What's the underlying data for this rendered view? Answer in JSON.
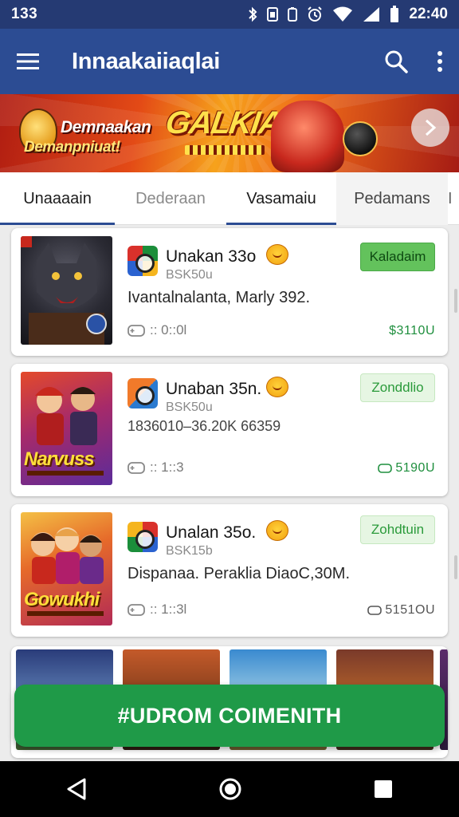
{
  "status_bar": {
    "time_left": "133",
    "clock": "22:40",
    "icons": [
      "bluetooth-icon",
      "sim-icon",
      "battery-saver-icon",
      "alarm-icon",
      "wifi-icon",
      "signal-icon",
      "battery-icon"
    ]
  },
  "app_bar": {
    "title": "Innaakaiiaqlai",
    "menu_icon": "menu-icon",
    "search_icon": "search-icon",
    "more_icon": "more-vert-icon",
    "color": "#2c4c93"
  },
  "banner": {
    "line1": "Demnaakan",
    "line2": "Demanpniuat!",
    "brand": "GALKIAN",
    "next_icon": "chevron-right-icon"
  },
  "tabs": [
    {
      "label": "Unaaaain",
      "active": true
    },
    {
      "label": "Dederaan",
      "active": false
    },
    {
      "label": "Vasamaiu",
      "active": true
    },
    {
      "label": "Pedamans",
      "active": false
    },
    {
      "label": "I",
      "active": false
    }
  ],
  "items": [
    {
      "name": "Unakan 33o",
      "sub": "BSK50u",
      "desc": "Ivantalnalanta, Marly 392.",
      "meta": ":: 0::0l",
      "price": "$3110U",
      "badge": "Kaladaim",
      "badge_style": "solid"
    },
    {
      "name": "Unaban 35n.",
      "sub": "BSK50u",
      "desc": "1836010–36.20K 66359",
      "meta": ":: 1::3",
      "price": "5190U",
      "badge": "Zonddlio",
      "badge_style": "light"
    },
    {
      "name": "Unalan 35o.",
      "sub": "BSK15b",
      "desc": "Dispanaa. Peraklia DiaoC,30M.",
      "meta": ":: 1::3l",
      "price": "5151OU",
      "badge": "Zohdtuin",
      "badge_style": "light"
    }
  ],
  "covers": [
    {
      "logo": ""
    },
    {
      "logo": "Narvuss"
    },
    {
      "logo": "Gowukhi"
    }
  ],
  "cta": {
    "label": "#UDROM COIMENITH",
    "color": "#1f9a48"
  },
  "nav_bar": {
    "back_icon": "back-triangle-icon",
    "home_icon": "home-circle-icon",
    "recents_icon": "recents-square-icon"
  }
}
